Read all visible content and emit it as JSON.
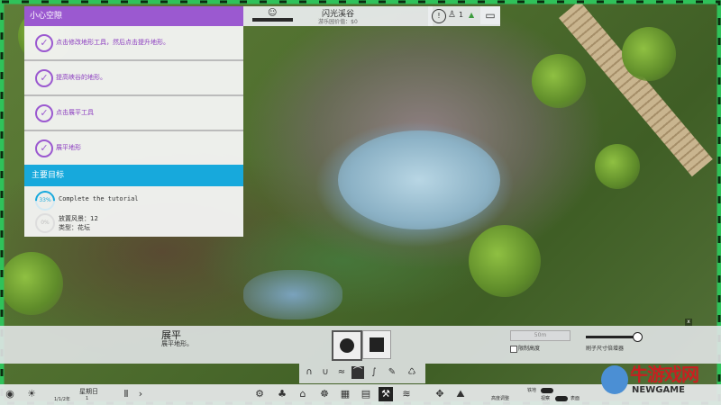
{
  "hud": {
    "park_name": "闪光溪谷",
    "park_sub": "游乐园价值：$0",
    "guest_count": "1"
  },
  "tutorial": {
    "title": "小心空隙",
    "tasks": [
      {
        "label": "点击修改地形工具，然后点击提升地形。"
      },
      {
        "label": "提高峡谷的地形。"
      },
      {
        "label": "点击展平工具"
      },
      {
        "label": "展平地形"
      }
    ],
    "goal_header": "主要目标",
    "goal1_progress": "33%",
    "goal1_label": "Complete the tutorial",
    "goal2_progress": "0%",
    "goal2_line1": "放置风景：12",
    "goal2_line2": "类型：花坛"
  },
  "tool": {
    "title": "展平",
    "subtitle": "展平地形。",
    "height_placeholder": "50m",
    "limit_height_label": "限制高度",
    "brush_size_label": "刷子尺寸倍增器"
  },
  "bottom": {
    "day": "星期日",
    "date": "1/1/2年",
    "rate": "1",
    "toggle1": "铁地",
    "toggle2": "表面",
    "toggle3": "高度调整",
    "toggle4": "视察"
  },
  "watermark": {
    "text": "牛游戏网",
    "sub": "NEWGAME"
  },
  "colors": {
    "accent_purple": "#9b59d0",
    "accent_blue": "#17a9dc",
    "frame_green": "#2fc25a"
  }
}
